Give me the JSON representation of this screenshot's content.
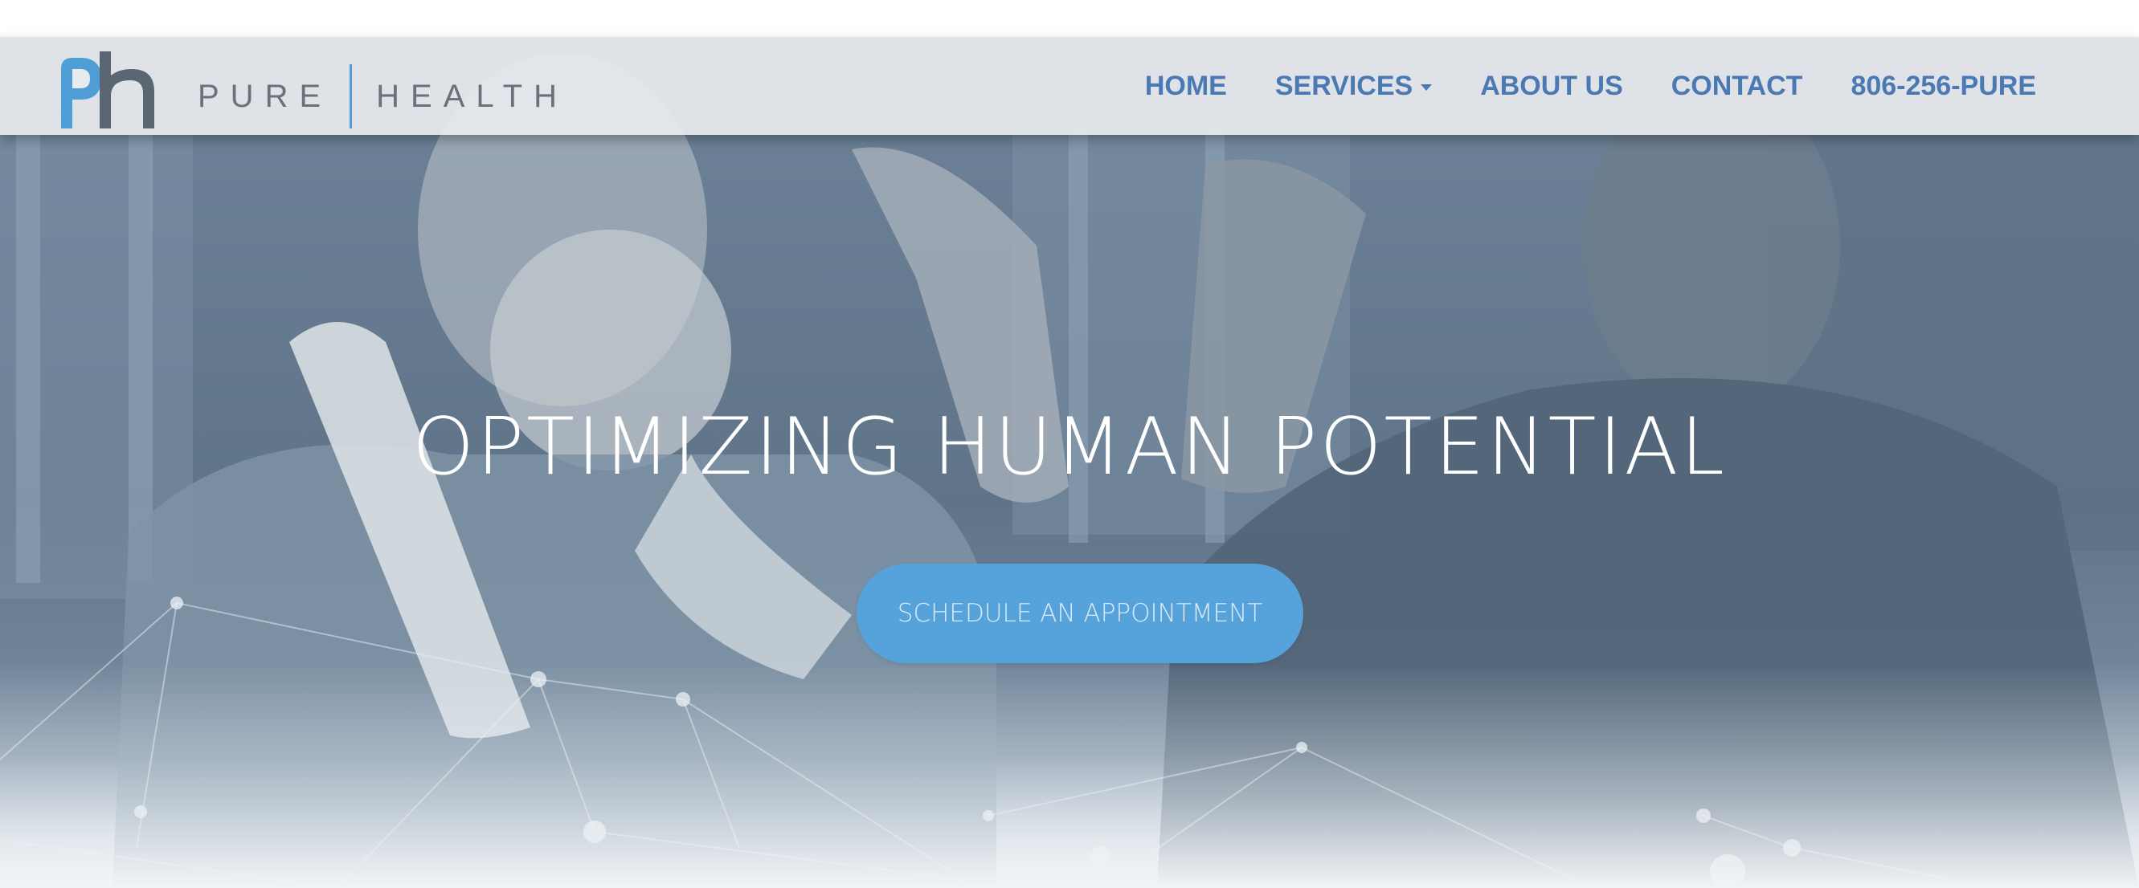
{
  "brand": {
    "name_part1": "PURE",
    "name_part2": "HEALTH",
    "logo_icon": "ph-logo-mark"
  },
  "nav": {
    "items": [
      {
        "label": "HOME"
      },
      {
        "label": "SERVICES",
        "has_dropdown": true
      },
      {
        "label": "ABOUT US"
      },
      {
        "label": "CONTACT"
      },
      {
        "label": "806-256-PURE"
      }
    ]
  },
  "hero": {
    "headline": "OPTIMIZING HUMAN POTENTIAL",
    "cta_label": "SCHEDULE AN APPOINTMENT"
  },
  "colors": {
    "accent_blue": "#56a3dc",
    "nav_text": "#4a79b3",
    "logo_gray": "#6a7279",
    "overlay_tint": "#5f7489"
  }
}
